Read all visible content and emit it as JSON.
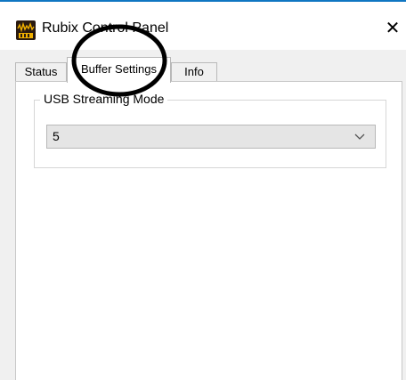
{
  "window": {
    "title": "Rubix Control Panel",
    "close_label": "✕",
    "accent_color": "#0f76c2"
  },
  "tabs": [
    {
      "label": "Status",
      "selected": false
    },
    {
      "label": "Buffer Settings",
      "selected": true
    },
    {
      "label": "Info",
      "selected": false
    }
  ],
  "usb_streaming": {
    "group_label": "USB Streaming Mode",
    "selected_value": "5",
    "icon": "chevron-down-icon"
  },
  "annotation": {
    "shape": "ellipse",
    "color": "#000000"
  }
}
